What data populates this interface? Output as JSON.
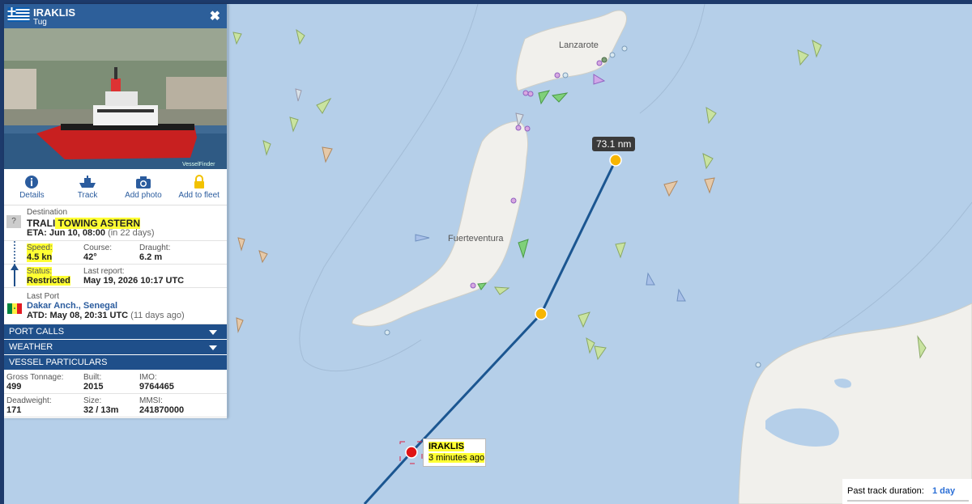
{
  "vessel": {
    "name": "IRAKLIS",
    "type": "Tug",
    "close_label": "✖",
    "watermark": "VesselFinder"
  },
  "actions": [
    {
      "label": "Details",
      "icon": "info-icon"
    },
    {
      "label": "Track",
      "icon": "ship-icon"
    },
    {
      "label": "Add photo",
      "icon": "camera-icon"
    },
    {
      "label": "Add to fleet",
      "icon": "lock-icon"
    }
  ],
  "voyage": {
    "destination_label": "Destination",
    "destination_prefix": "TRALI",
    "destination_highlight": " TOWING ASTERN",
    "unknown_port_icon": "?",
    "eta": "ETA: Jun 10, 08:00",
    "eta_note": "(in 22 days)",
    "speed_label": "Speed:",
    "speed": "4.5 kn",
    "course_label": "Course:",
    "course": "42°",
    "draught_label": "Draught:",
    "draught": "6.2 m",
    "status_label": "Status:",
    "status": "Restricted",
    "last_report_label": "Last report:",
    "last_report": "May 19, 2026 10:17 UTC",
    "last_port_label": "Last Port",
    "last_port": "Dakar Anch., Senegal",
    "atd": "ATD: May 08, 20:31 UTC",
    "atd_note": "(11 days ago)"
  },
  "sections": {
    "port_calls": "PORT CALLS",
    "weather": "WEATHER",
    "particulars": "VESSEL PARTICULARS"
  },
  "particulars": {
    "gt_label": "Gross Tonnage:",
    "gt": "499",
    "built_label": "Built:",
    "built": "2015",
    "imo_label": "IMO:",
    "imo": "9764465",
    "dwt_label": "Deadweight:",
    "dwt": "171",
    "size_label": "Size:",
    "size": "32 / 13m",
    "mmsi_label": "MMSI:",
    "mmsi": "241870000"
  },
  "map": {
    "island_1": "Lanzarote",
    "island_2": "Fuerteventura",
    "distance": "73.1 nm",
    "vessel_label": "IRAKLIS",
    "vessel_age": "3 minutes ago",
    "track_duration_label": "Past track duration:",
    "track_duration": "1 day"
  },
  "colors": {
    "header": "#2d5f9a",
    "section_bar": "#1f4f8a",
    "track_line": "#1b5691",
    "track_point": "#f7b500",
    "vessel_dot": "#e01414",
    "sea": "#b5cfe9",
    "land": "#f1f0ec",
    "highlight": "#ffff33"
  }
}
